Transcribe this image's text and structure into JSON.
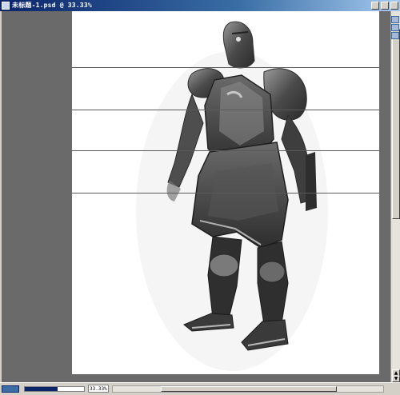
{
  "window": {
    "title": "未标题-1.psd @ 33.33%",
    "title_icon": "photoshop-doc-icon",
    "controls": [
      "minimize-icon",
      "maximize-icon",
      "close-icon"
    ]
  },
  "document": {
    "artwork": "armored-knight-painting",
    "background_color": "#ffffff"
  },
  "statusbar": {
    "zoom": "33.33%",
    "progress_fraction": 0.55
  },
  "colors": {
    "titlebar_start": "#0a246a",
    "workspace": "#6a6a6a",
    "chrome": "#d4d0c8"
  }
}
